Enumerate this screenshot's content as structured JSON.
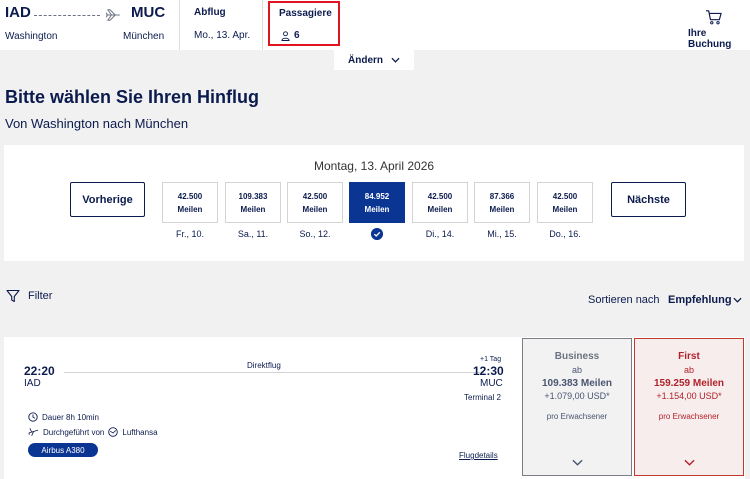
{
  "header": {
    "origin_code": "IAD",
    "origin_city": "Washington",
    "destination_code": "MUC",
    "destination_city": "München",
    "departure_label": "Abflug",
    "departure_date": "Mo., 13. Apr.",
    "passengers_label": "Passagiere",
    "passengers_count": "6",
    "booking_label": "Ihre Buchung"
  },
  "change_button": "Ändern",
  "page_title": "Bitte wählen Sie Ihren Hinflug",
  "subtitle": "Von Washington nach München",
  "date_selector": {
    "title": "Montag, 13. April 2026",
    "prev_label": "Vorherige",
    "next_label": "Nächste",
    "days": [
      {
        "value": "42.500",
        "unit": "Meilen",
        "label": "Fr., 10.",
        "selected": false
      },
      {
        "value": "109.383",
        "unit": "Meilen",
        "label": "Sa., 11.",
        "selected": false
      },
      {
        "value": "42.500",
        "unit": "Meilen",
        "label": "So., 12.",
        "selected": false
      },
      {
        "value": "84.952",
        "unit": "Meilen",
        "label": "",
        "selected": true
      },
      {
        "value": "42.500",
        "unit": "Meilen",
        "label": "Di., 14.",
        "selected": false
      },
      {
        "value": "87.366",
        "unit": "Meilen",
        "label": "Mi., 15.",
        "selected": false
      },
      {
        "value": "42.500",
        "unit": "Meilen",
        "label": "Do., 16.",
        "selected": false
      }
    ]
  },
  "filter_label": "Filter",
  "sort": {
    "label": "Sortieren nach",
    "value": "Empfehlung"
  },
  "flight": {
    "departure_time": "22:20",
    "departure_code": "IAD",
    "arrival_time": "12:30",
    "arrival_code": "MUC",
    "next_day": "+1 Tag",
    "terminal": "Terminal 2",
    "type": "Direktflug",
    "duration": "Dauer 8h 10min",
    "operated_by": "Durchgeführt von",
    "airline": "Lufthansa",
    "aircraft": "Airbus A380",
    "details_link": "Flugdetails",
    "fares": [
      {
        "name": "Business",
        "from": "ab",
        "miles": "109.383 Meilen",
        "usd": "+1.079,00 USD*",
        "per": "pro Erwachsener"
      },
      {
        "name": "First",
        "from": "ab",
        "miles": "159.259 Meilen",
        "usd": "+1.154,00 USD*",
        "per": "pro Erwachsener"
      }
    ]
  },
  "colors": {
    "brand_navy": "#0b1b4d",
    "selected_blue": "#0b3593",
    "highlight_red": "#e0141e",
    "first_red": "#b0222b"
  }
}
